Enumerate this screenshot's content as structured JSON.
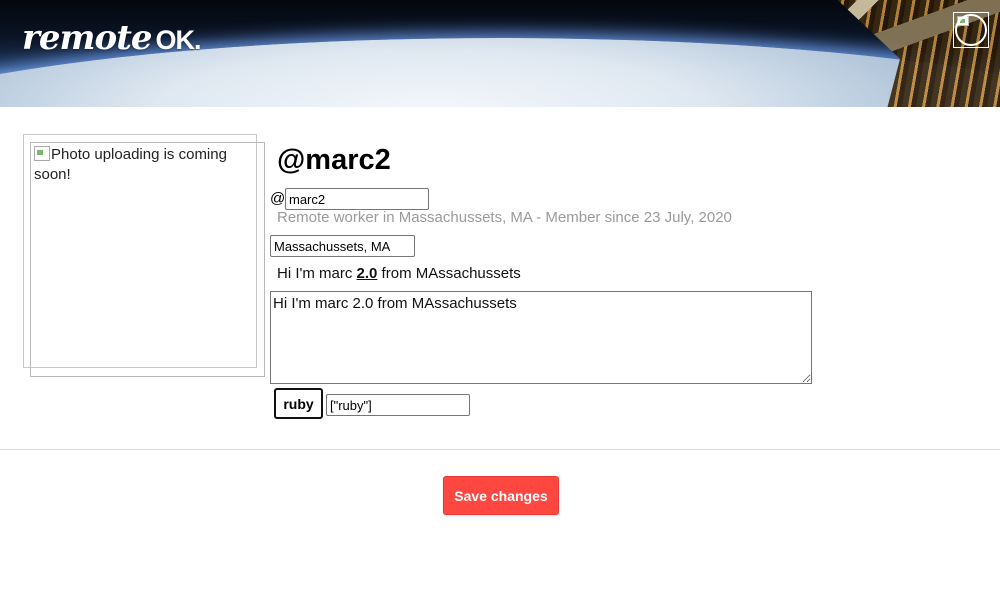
{
  "header": {
    "logo_text": "remote",
    "logo_ok": "OK.",
    "avatar_icon": "user-avatar-icon"
  },
  "profile": {
    "photo_alt": "Photo uploading is coming soon!",
    "title": "@marc2",
    "at_prefix": "@",
    "username_value": "marc2",
    "meta": "Remote worker in Massachussets, MA - Member since 23 July, 2020",
    "location_value": "Massachussets, MA",
    "bio_before": "Hi I'm marc ",
    "bio_version": "2.0",
    "bio_after": " from MAssachussets",
    "bio_value": "Hi I'm marc 2.0 from MAssachussets",
    "tag_label": "ruby",
    "tags_value": "[\"ruby\"]"
  },
  "actions": {
    "save_label": "Save changes"
  },
  "colors": {
    "accent": "#ff4742",
    "meta_text": "#9a9a9a"
  }
}
